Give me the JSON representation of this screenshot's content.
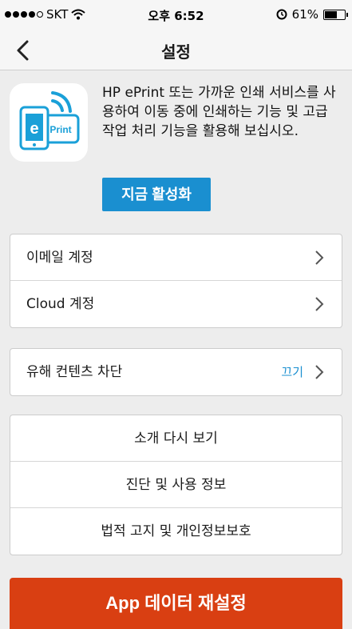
{
  "status_bar": {
    "carrier": "SKT",
    "time": "오후 6:52",
    "battery": "61%",
    "battery_level": 0.61
  },
  "nav": {
    "title": "설정"
  },
  "promo": {
    "description": "HP ePrint 또는 가까운 인쇄 서비스를 사용하여 이동 중에 인쇄하는 기능 및 고급 작업 처리 기능을 활용해 보십시오.",
    "activate_label": "지금 활성화",
    "icon": "hp-eprint-app-icon"
  },
  "accounts": [
    {
      "label": "이메일 계정"
    },
    {
      "label": "Cloud 계정"
    }
  ],
  "content_block": {
    "label": "유해 컨텐츠 차단",
    "value": "끄기"
  },
  "info": [
    {
      "label": "소개 다시 보기"
    },
    {
      "label": "진단 및 사용 정보"
    },
    {
      "label": "법적 고지 및 개인정보보호"
    }
  ],
  "reset": {
    "label": "App 데이터 재설정"
  },
  "colors": {
    "accent": "#1a8fd0",
    "danger": "#d93f12",
    "background": "#ededed"
  }
}
